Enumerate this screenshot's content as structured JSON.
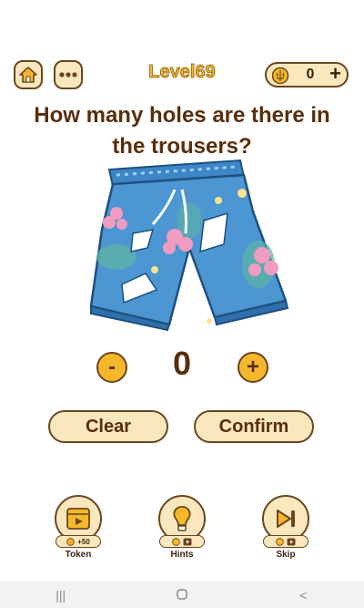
{
  "header": {
    "level": "Level69",
    "coins": "0"
  },
  "question": {
    "line1": "How many holes are there in",
    "line2": "the trousers?"
  },
  "stepper": {
    "minus": "-",
    "value": "0",
    "plus": "+"
  },
  "actions": {
    "clear": "Clear",
    "confirm": "Confirm"
  },
  "tools": [
    {
      "label": "Token",
      "badge": "+50",
      "icon": "film-icon"
    },
    {
      "label": "Hints",
      "badge": "",
      "icon": "lightbulb-icon"
    },
    {
      "label": "Skip",
      "badge": "",
      "icon": "skip-icon"
    }
  ],
  "colors": {
    "accent": "#f5b82a",
    "button_bg": "#fbe7bd",
    "text": "#5a2e0c",
    "shorts": "#4b96d3"
  }
}
